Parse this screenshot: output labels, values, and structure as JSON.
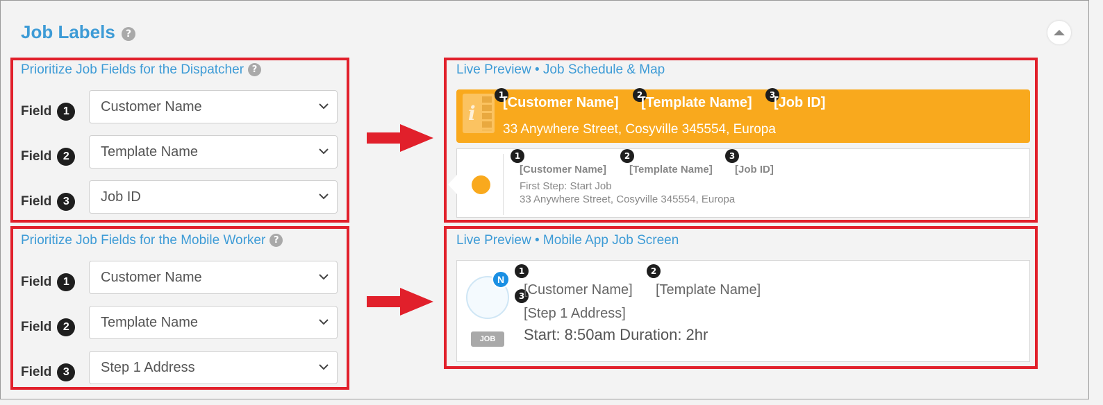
{
  "panel": {
    "title": "Job Labels",
    "help_glyph": "?",
    "collapse_icon": "chevron-up-icon"
  },
  "dispatcher": {
    "title": "Prioritize Job Fields for the Dispatcher",
    "field_label": "Field",
    "fields": [
      {
        "num": "1",
        "value": "Customer Name"
      },
      {
        "num": "2",
        "value": "Template Name"
      },
      {
        "num": "3",
        "value": "Job ID"
      }
    ]
  },
  "mobile_worker": {
    "title": "Prioritize Job Fields for the Mobile Worker",
    "field_label": "Field",
    "fields": [
      {
        "num": "1",
        "value": "Customer Name"
      },
      {
        "num": "2",
        "value": "Template Name"
      },
      {
        "num": "3",
        "value": "Step 1 Address"
      }
    ]
  },
  "preview_schedule": {
    "title": "Live Preview • Job Schedule & Map",
    "bar_fields": [
      "[Customer Name]",
      "[Template Name]",
      "[Job ID]"
    ],
    "bar_address": "33 Anywhere Street, Cosyville 345554, Europa",
    "card_fields": [
      "[Customer Name]",
      "[Template Name]",
      "[Job ID]"
    ],
    "card_step": "First Step: Start Job",
    "card_address": "33 Anywhere Street, Cosyville 345554, Europa",
    "badges": [
      "1",
      "2",
      "3"
    ]
  },
  "preview_mobile": {
    "title": "Live Preview • Mobile App Job Screen",
    "avatar_letter": "N",
    "job_tag": "JOB",
    "fields": [
      "[Customer Name]",
      "[Template Name]",
      "[Step 1 Address]"
    ],
    "start_line": "Start: 8:50am Duration: 2hr",
    "badges": [
      "1",
      "2",
      "3"
    ]
  },
  "colors": {
    "accent_blue": "#3d9bd6",
    "highlight_red": "#e1202b",
    "orange": "#f9a91d",
    "badge_dark": "#1e1e1e"
  }
}
